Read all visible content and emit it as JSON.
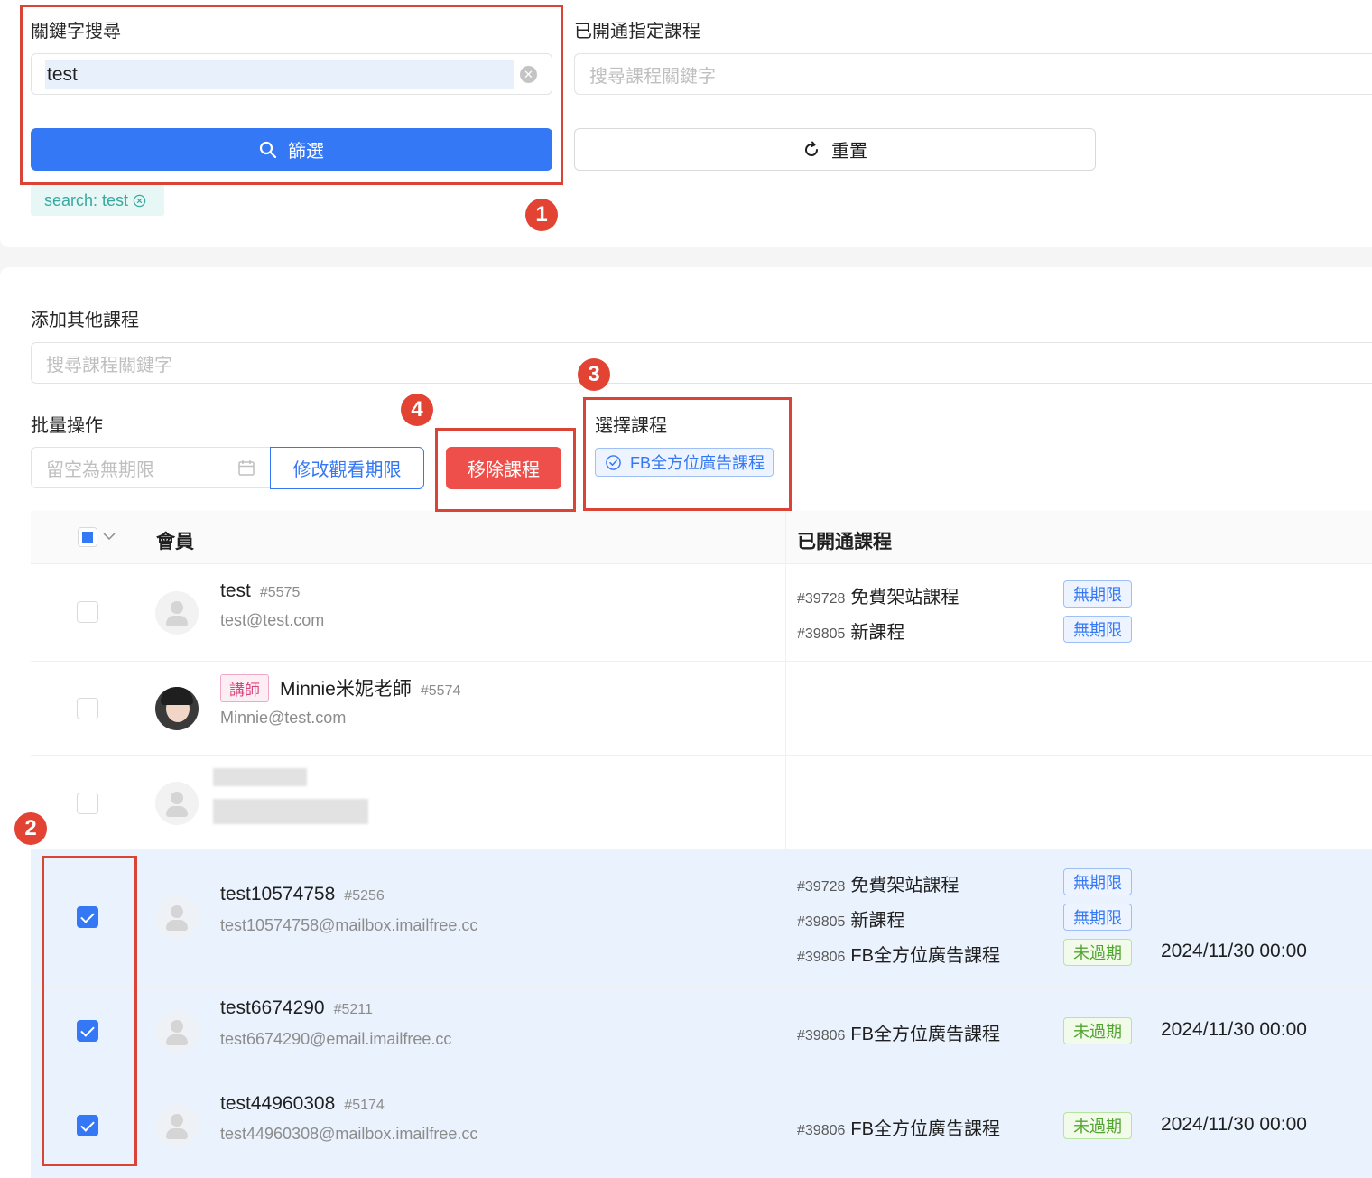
{
  "filters": {
    "keyword_label": "關鍵字搜尋",
    "keyword_value": "test",
    "filter_button": "篩選",
    "active_tag": "search: test",
    "course_label": "已開通指定課程",
    "course_placeholder": "搜尋課程關鍵字",
    "reset_button": "重置"
  },
  "add_course": {
    "label": "添加其他課程",
    "placeholder": "搜尋課程關鍵字"
  },
  "batch": {
    "label": "批量操作",
    "date_placeholder": "留空為無期限",
    "modify_button": "修改觀看期限",
    "remove_button": "移除課程",
    "select_label": "選擇課程",
    "selected_course": "FB全方位廣告課程"
  },
  "annotations": [
    "1",
    "2",
    "3",
    "4"
  ],
  "table": {
    "col_member": "會員",
    "col_courses": "已開通課程",
    "rows": [
      {
        "name": "test",
        "id": "#5575",
        "email": "test@test.com",
        "checked": false,
        "role": "",
        "courses": [
          {
            "id": "#39728",
            "name": "免費架站課程",
            "status": "無期限",
            "date": ""
          },
          {
            "id": "#39805",
            "name": "新課程",
            "status": "無期限",
            "date": ""
          }
        ]
      },
      {
        "name": "Minnie米妮老師",
        "id": "#5574",
        "email": "Minnie@test.com",
        "checked": false,
        "role": "講師",
        "courses": []
      },
      {
        "name": "",
        "id": "",
        "email": "",
        "checked": false,
        "role": "",
        "courses": []
      },
      {
        "name": "test10574758",
        "id": "#5256",
        "email": "test10574758@mailbox.imailfree.cc",
        "checked": true,
        "role": "",
        "courses": [
          {
            "id": "#39728",
            "name": "免費架站課程",
            "status": "無期限",
            "date": ""
          },
          {
            "id": "#39805",
            "name": "新課程",
            "status": "無期限",
            "date": ""
          },
          {
            "id": "#39806",
            "name": "FB全方位廣告課程",
            "status": "未過期",
            "date": "2024/11/30 00:00"
          }
        ]
      },
      {
        "name": "test6674290",
        "id": "#5211",
        "email": "test6674290@email.imailfree.cc",
        "checked": true,
        "role": "",
        "courses": [
          {
            "id": "#39806",
            "name": "FB全方位廣告課程",
            "status": "未過期",
            "date": "2024/11/30 00:00"
          }
        ]
      },
      {
        "name": "test44960308",
        "id": "#5174",
        "email": "test44960308@mailbox.imailfree.cc",
        "checked": true,
        "role": "",
        "courses": [
          {
            "id": "#39806",
            "name": "FB全方位廣告課程",
            "status": "未過期",
            "date": "2024/11/30 00:00"
          }
        ]
      }
    ]
  },
  "colors": {
    "primary": "#3478f5",
    "danger": "#ef4f4a",
    "annotation_red": "#d94436",
    "selected_row": "#eaf2fd"
  }
}
